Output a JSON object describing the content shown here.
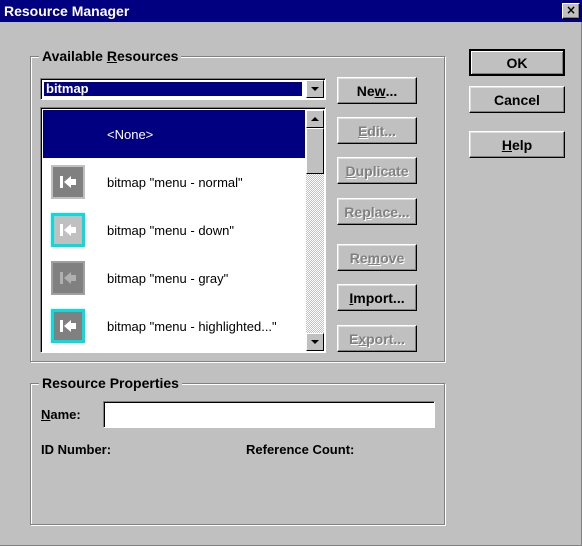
{
  "window": {
    "title": "Resource Manager",
    "close_label": "×"
  },
  "available": {
    "group_title_prefix": "Available ",
    "group_title_key": "R",
    "group_title_suffix": "esources",
    "combo_value": "bitmap",
    "items": [
      {
        "label": "<None>",
        "icon": "none",
        "selected": true
      },
      {
        "label": "bitmap \"menu - normal\"",
        "icon": "arrow-left-bar-icon"
      },
      {
        "label": "bitmap \"menu - down\"",
        "icon": "arrow-left-bar-icon"
      },
      {
        "label": "bitmap \"menu - gray\"",
        "icon": "arrow-left-bar-icon"
      },
      {
        "label": "bitmap \"menu - highlighted...\"",
        "icon": "arrow-left-bar-icon"
      }
    ]
  },
  "buttons": {
    "new": {
      "pre": "Ne",
      "key": "w",
      "post": "...",
      "enabled": true
    },
    "edit": {
      "pre": "",
      "key": "E",
      "post": "dit...",
      "enabled": false
    },
    "duplicate": {
      "pre": "",
      "key": "D",
      "post": "uplicate",
      "enabled": false
    },
    "replace": {
      "pre": "Re",
      "key": "p",
      "post": "lace...",
      "enabled": false
    },
    "remove": {
      "pre": "Re",
      "key": "m",
      "post": "ove",
      "enabled": false
    },
    "import": {
      "pre": "",
      "key": "I",
      "post": "mport...",
      "enabled": true
    },
    "export": {
      "pre": "E",
      "key": "x",
      "post": "port...",
      "enabled": false
    },
    "ok": "OK",
    "cancel": "Cancel",
    "help": {
      "pre": "",
      "key": "H",
      "post": "elp"
    }
  },
  "properties": {
    "group_title": "Resource Properties",
    "name_key": "N",
    "name_rest": "ame:",
    "name_value": "",
    "id_label": "ID Number:",
    "ref_label": "Reference Count:"
  },
  "colors": {
    "titlebar": "#000080",
    "face": "#c0c0c0",
    "highlight_border": "#00e0e0"
  }
}
